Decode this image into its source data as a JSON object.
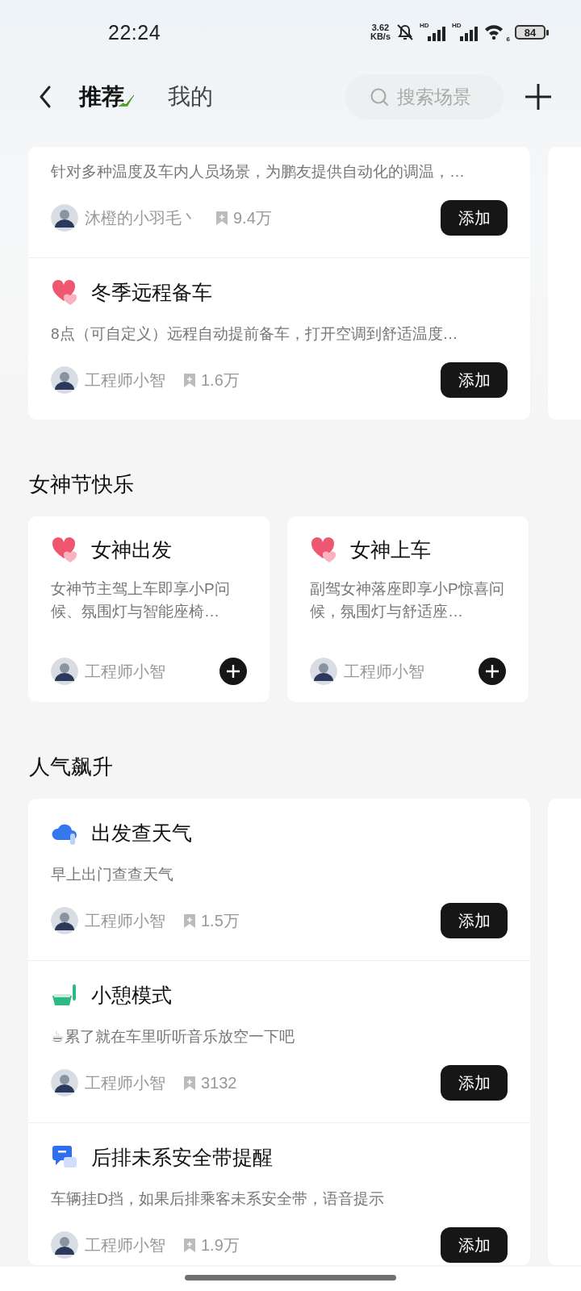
{
  "status_bar": {
    "time": "22:24",
    "speed_value": "3.62",
    "speed_unit": "KB/s",
    "muted": true,
    "signals": [
      {
        "label": "HD"
      },
      {
        "label": "HD"
      }
    ],
    "wifi_label": "6",
    "battery": "84"
  },
  "header": {
    "tabs": [
      {
        "label": "推荐",
        "selected": true
      },
      {
        "label": "我的",
        "selected": false
      }
    ],
    "search": {
      "placeholder": "搜索场景"
    }
  },
  "sections": [
    {
      "kind": "list",
      "has_next_card": true,
      "cards": [
        {
          "items": [
            {
              "description": "针对多种温度及车内人员场景，为鹏友提供自动化的调温，…",
              "author": "沐橙的小羽毛丶",
              "saves": "9.4万",
              "action": "添加"
            },
            {
              "kind": "heart",
              "title": "冬季远程备车",
              "description": "8点（可自定义）远程自动提前备车，打开空调到舒适温度…",
              "author": "工程师小智",
              "saves": "1.6万",
              "action": "添加"
            }
          ]
        }
      ]
    },
    {
      "title": "女神节快乐",
      "kind": "grid",
      "has_next_card": false,
      "cards": [
        {
          "items": [
            {
              "kind": "heart",
              "title": "女神出发",
              "description": "女神节主驾上车即享小P问候、氛围灯与智能座椅…",
              "author": "工程师小智"
            }
          ]
        },
        {
          "items": [
            {
              "kind": "heart",
              "title": "女神上车",
              "description": "副驾女神落座即享小P惊喜问候，氛围灯与舒适座…",
              "author": "工程师小智"
            }
          ]
        }
      ]
    },
    {
      "title": "人气飙升",
      "kind": "list",
      "has_next_card": true,
      "cards": [
        {
          "items": [
            {
              "kind": "cloud",
              "title": "出发查天气",
              "description": "早上出门查查天气",
              "author": "工程师小智",
              "saves": "1.5万",
              "action": "添加"
            },
            {
              "kind": "tray",
              "title": "小憩模式",
              "description": "☕累了就在车里听听音乐放空一下吧",
              "author": "工程师小智",
              "saves": "3132",
              "action": "添加"
            },
            {
              "kind": "chat",
              "title": "后排未系安全带提醒",
              "description": "车辆挂D挡，如果后排乘客未系安全带，语音提示",
              "author": "工程师小智",
              "saves": "1.9万",
              "action": "添加"
            }
          ]
        }
      ]
    }
  ]
}
